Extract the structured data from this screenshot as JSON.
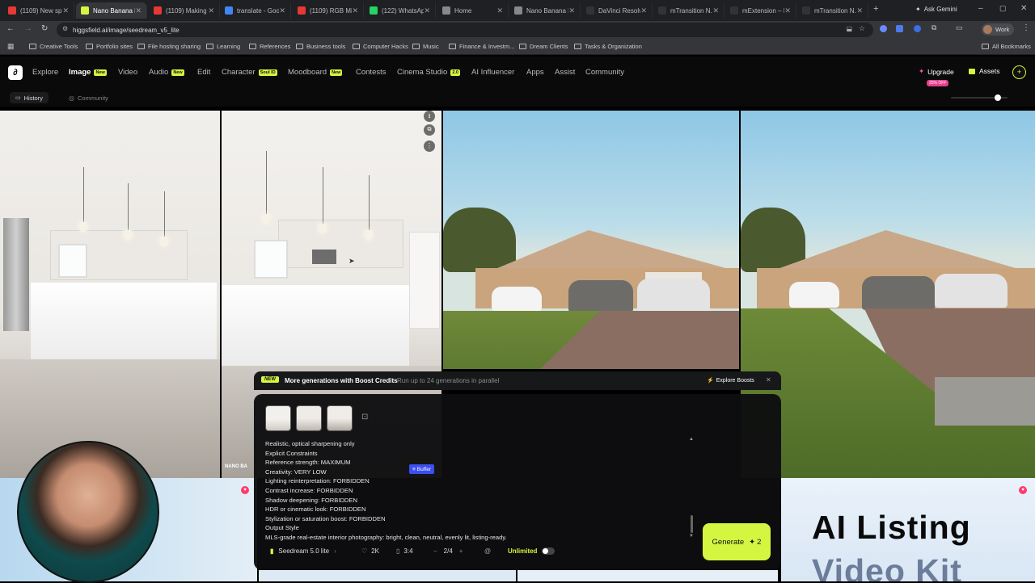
{
  "browser": {
    "tabs": [
      {
        "title": "(1109) New sp...",
        "color": "#e53935",
        "active": false
      },
      {
        "title": "Nano Banana P...",
        "color": "#d5f641",
        "active": true
      },
      {
        "title": "(1109) Making ...",
        "color": "#e53935",
        "active": false
      },
      {
        "title": "translate - Goo...",
        "color": "#4285f4",
        "active": false
      },
      {
        "title": "(1109) RGB Mi...",
        "color": "#e53935",
        "active": false
      },
      {
        "title": "(122) WhatsAp...",
        "color": "#25d366",
        "active": false
      },
      {
        "title": "Home",
        "color": "#888888",
        "active": false
      },
      {
        "title": "Nano Banana P...",
        "color": "#888888",
        "active": false
      },
      {
        "title": "DaVinci Resolv...",
        "color": "#333333",
        "active": false
      },
      {
        "title": "mTransition N...",
        "color": "#333333",
        "active": false
      },
      {
        "title": "mExtension – I...",
        "color": "#333333",
        "active": false
      },
      {
        "title": "mTransition N...",
        "color": "#333333",
        "active": false
      }
    ],
    "new_tab": "+",
    "ask_gemini": "Ask Gemini",
    "url": "higgsfield.ai/image/seedream_v5_lite",
    "profile": "Work",
    "bookmarks": [
      "Creative Tools",
      "Portfolio sites",
      "File hosting sharing",
      "Learning",
      "References",
      "Business tools",
      "Computer Hacks",
      "Music",
      "Finance & Investm...",
      "Dream Clients",
      "Tasks & Organization"
    ],
    "all_bookmarks": "All Bookmarks"
  },
  "site": {
    "nav": [
      {
        "label": "Explore",
        "badge": ""
      },
      {
        "label": "Image",
        "badge": "New"
      },
      {
        "label": "Video",
        "badge": ""
      },
      {
        "label": "Audio",
        "badge": "New"
      },
      {
        "label": "Edit",
        "badge": ""
      },
      {
        "label": "Character",
        "badge": "Soul ID"
      },
      {
        "label": "Moodboard",
        "badge": "New"
      },
      {
        "label": "Contests",
        "badge": ""
      },
      {
        "label": "Cinema Studio",
        "badge": "2.0"
      },
      {
        "label": "AI Influencer",
        "badge": ""
      },
      {
        "label": "Apps",
        "badge": ""
      },
      {
        "label": "Assist",
        "badge": ""
      },
      {
        "label": "Community",
        "badge": ""
      }
    ],
    "upgrade": "Upgrade",
    "upgrade_discount": "25% OFF",
    "assets": "Assets",
    "subnav": {
      "history": "History",
      "community": "Community"
    }
  },
  "gallery": {
    "watermark": "NANO BA",
    "ad_title_line1": "AI Listing",
    "ad_title_line2": "Video Kit"
  },
  "boost_banner": {
    "badge": "NEW",
    "title": "More generations with Boost Credits",
    "subtitle": "Run up to 24 generations in parallel",
    "cta": "Explore Boosts"
  },
  "prompt": {
    "lines": [
      "Realistic, optical sharpening only",
      "Explicit Constraints",
      "Reference strength: MAXIMUM",
      "Creativity: VERY LOW",
      "Lighting reinterpretation: FORBIDDEN",
      "Contrast increase: FORBIDDEN",
      "Shadow deepening: FORBIDDEN",
      "HDR or cinematic look: FORBIDDEN",
      "Stylization or saturation boost: FORBIDDEN",
      "Output Style",
      "MLS-grade real-estate interior photography: bright, clean, neutral, evenly lit, listing-ready."
    ],
    "buffer_tag": "Buffer"
  },
  "controls": {
    "model": "Seedream 5.0 lite",
    "quality": "2K",
    "aspect": "3:4",
    "count": "2/4",
    "unlimited": "Unlimited",
    "generate": "Generate",
    "generate_cost": "2"
  },
  "colors": {
    "accent": "#d5f641",
    "buffer": "#3b4ef0"
  }
}
